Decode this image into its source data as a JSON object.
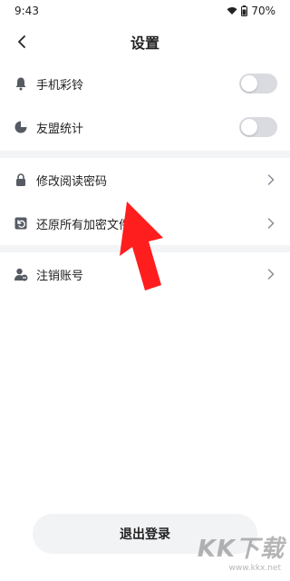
{
  "status_bar": {
    "time": "9:43",
    "battery": "70%"
  },
  "header": {
    "title": "设置"
  },
  "settings": {
    "ringtone": {
      "label": "手机彩铃",
      "enabled": false
    },
    "alliance_stats": {
      "label": "友盟统计",
      "enabled": false
    },
    "change_password": {
      "label": "修改阅读密码"
    },
    "restore_files": {
      "label": "还原所有加密文件"
    },
    "cancel_account": {
      "label": "注销账号"
    }
  },
  "footer": {
    "logout_label": "退出登录"
  },
  "watermark": {
    "main": "KK下载",
    "sub": "www.kkx.net"
  },
  "colors": {
    "arrow": "#ff1e1e",
    "toggle_off": "#d9dbe0",
    "divider": "#f3f4f6",
    "button_bg": "#f2f3f5"
  }
}
